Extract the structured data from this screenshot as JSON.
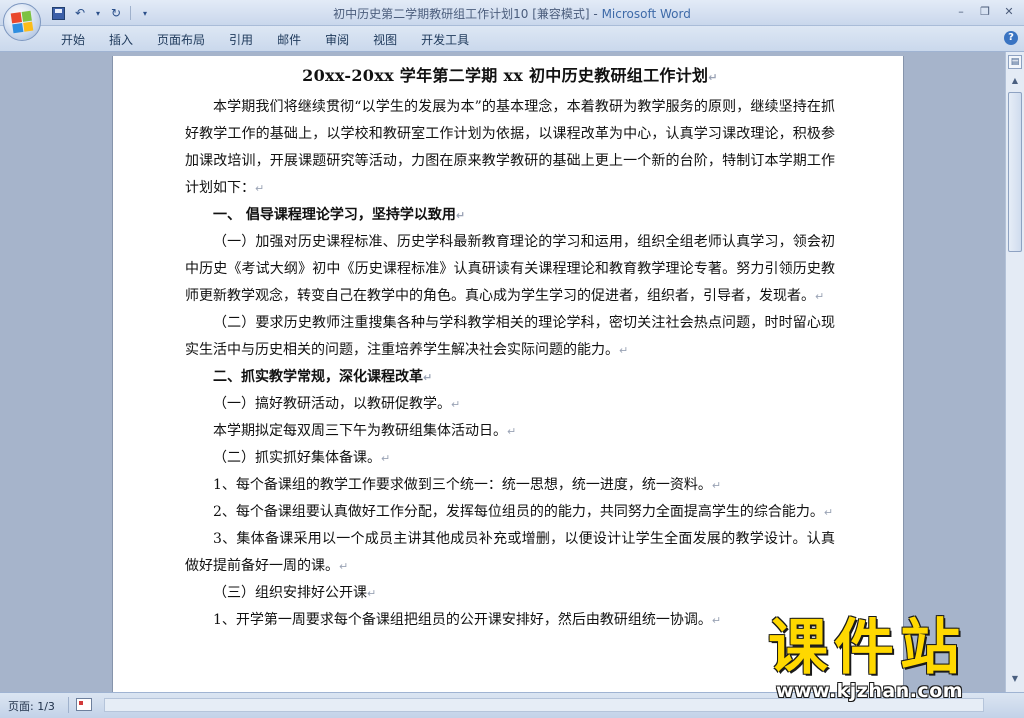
{
  "window": {
    "title": "初中历史第二学期教研组工作计划10 [兼容模式]",
    "title_sep": " - ",
    "app_name": "Microsoft Word",
    "controls": {
      "minimize": "–",
      "restore": "❐",
      "close": "✕"
    }
  },
  "qat": {
    "save_icon": "save-icon",
    "undo_glyph": "↶",
    "redo_glyph": "↻",
    "customize_glyph": "▾"
  },
  "ribbon": {
    "tabs": [
      "开始",
      "插入",
      "页面布局",
      "引用",
      "邮件",
      "审阅",
      "视图",
      "开发工具"
    ],
    "help_glyph": "?"
  },
  "document": {
    "title": "20xx-20xx 学年第二学期 xx 初中历史教研组工作计划",
    "blocks": [
      {
        "type": "para",
        "indent": true,
        "text": "本学期我们将继续贯彻“以学生的发展为本”的基本理念，本着教研为教学服务的原则，继续坚持在抓好教学工作的基础上，以学校和教研室工作计划为依据，以课程改革为中心，认真学习课改理论，积极参加课改培训，开展课题研究等活动，力图在原来教学教研的基础上更上一个新的台阶，特制订本学期工作计划如下："
      },
      {
        "type": "heading",
        "text": "一、  倡导课程理论学习，坚持学以致用"
      },
      {
        "type": "para",
        "indent": true,
        "text": "（一）加强对历史课程标准、历史学科最新教育理论的学习和运用，组织全组老师认真学习，领会初中历史《考试大纲》初中《历史课程标准》认真研读有关课程理论和教育教学理论专著。努力引领历史教师更新教学观念，转变自己在教学中的角色。真心成为学生学习的促进者，组织者，引导者，发现者。"
      },
      {
        "type": "para",
        "indent": true,
        "text": "（二）要求历史教师注重搜集各种与学科教学相关的理论学科，密切关注社会热点问题，时时留心现实生活中与历史相关的问题，注重培养学生解决社会实际问题的能力。"
      },
      {
        "type": "heading",
        "text": "二、抓实教学常规，深化课程改革"
      },
      {
        "type": "para",
        "indent": true,
        "text": "（一）搞好教研活动，以教研促教学。"
      },
      {
        "type": "para",
        "indent": true,
        "text": "本学期拟定每双周三下午为教研组集体活动日。"
      },
      {
        "type": "para",
        "indent": true,
        "text": "（二）抓实抓好集体备课。"
      },
      {
        "type": "para",
        "indent": true,
        "text": "1、每个备课组的教学工作要求做到三个统一：统一思想，统一进度，统一资料。"
      },
      {
        "type": "para",
        "indent": true,
        "text": "2、每个备课组要认真做好工作分配，发挥每位组员的的能力，共同努力全面提高学生的综合能力。"
      },
      {
        "type": "para",
        "indent": true,
        "text": "3、集体备课采用以一个成员主讲其他成员补充或增删，以便设计让学生全面发展的教学设计。认真做好提前备好一周的课。"
      },
      {
        "type": "para",
        "indent": true,
        "text": "（三）组织安排好公开课"
      },
      {
        "type": "para",
        "indent": true,
        "text": "1、开学第一周要求每个备课组把组员的公开课安排好，然后由教研组统一协调。"
      }
    ],
    "paragraph_mark": "↵"
  },
  "scrollbar": {
    "ruler_glyph": "▤",
    "up_glyph": "▲",
    "down_glyph": "▼"
  },
  "status": {
    "page": "页面: 1/3"
  },
  "watermark": {
    "brand": "课件站",
    "url": "www.kjzhan.com"
  },
  "colors": {
    "accent": "#3e6aa8",
    "watermark_yellow": "#ffd800"
  }
}
